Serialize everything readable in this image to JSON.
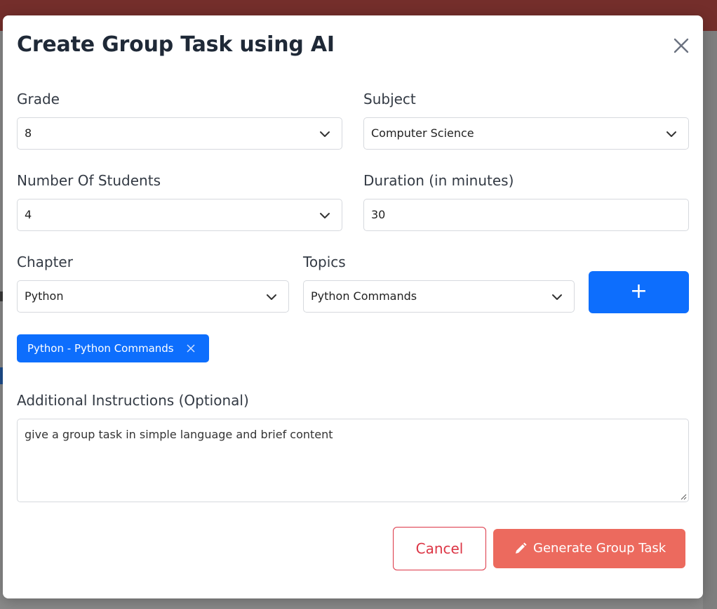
{
  "modal": {
    "title": "Create Group Task using AI",
    "close_icon": "close-icon"
  },
  "form": {
    "grade": {
      "label": "Grade",
      "value": "8"
    },
    "subject": {
      "label": "Subject",
      "value": "Computer Science"
    },
    "students": {
      "label": "Number Of Students",
      "value": "4"
    },
    "duration": {
      "label": "Duration (in minutes)",
      "value": "30"
    },
    "chapter": {
      "label": "Chapter",
      "value": "Python"
    },
    "topics": {
      "label": "Topics",
      "value": "Python Commands"
    },
    "add_button": {
      "label": "+"
    },
    "selected_topics": [
      "Python - Python Commands"
    ],
    "instructions": {
      "label": "Additional Instructions (Optional)",
      "value": "give a group task in simple language and brief content"
    }
  },
  "actions": {
    "cancel": "Cancel",
    "generate": "Generate Group Task",
    "generate_icon": "pencil-icon"
  },
  "colors": {
    "primary": "#0d6efd",
    "danger": "#dc3545",
    "generate": "#ec6a5e",
    "topbar": "#742e2b"
  }
}
